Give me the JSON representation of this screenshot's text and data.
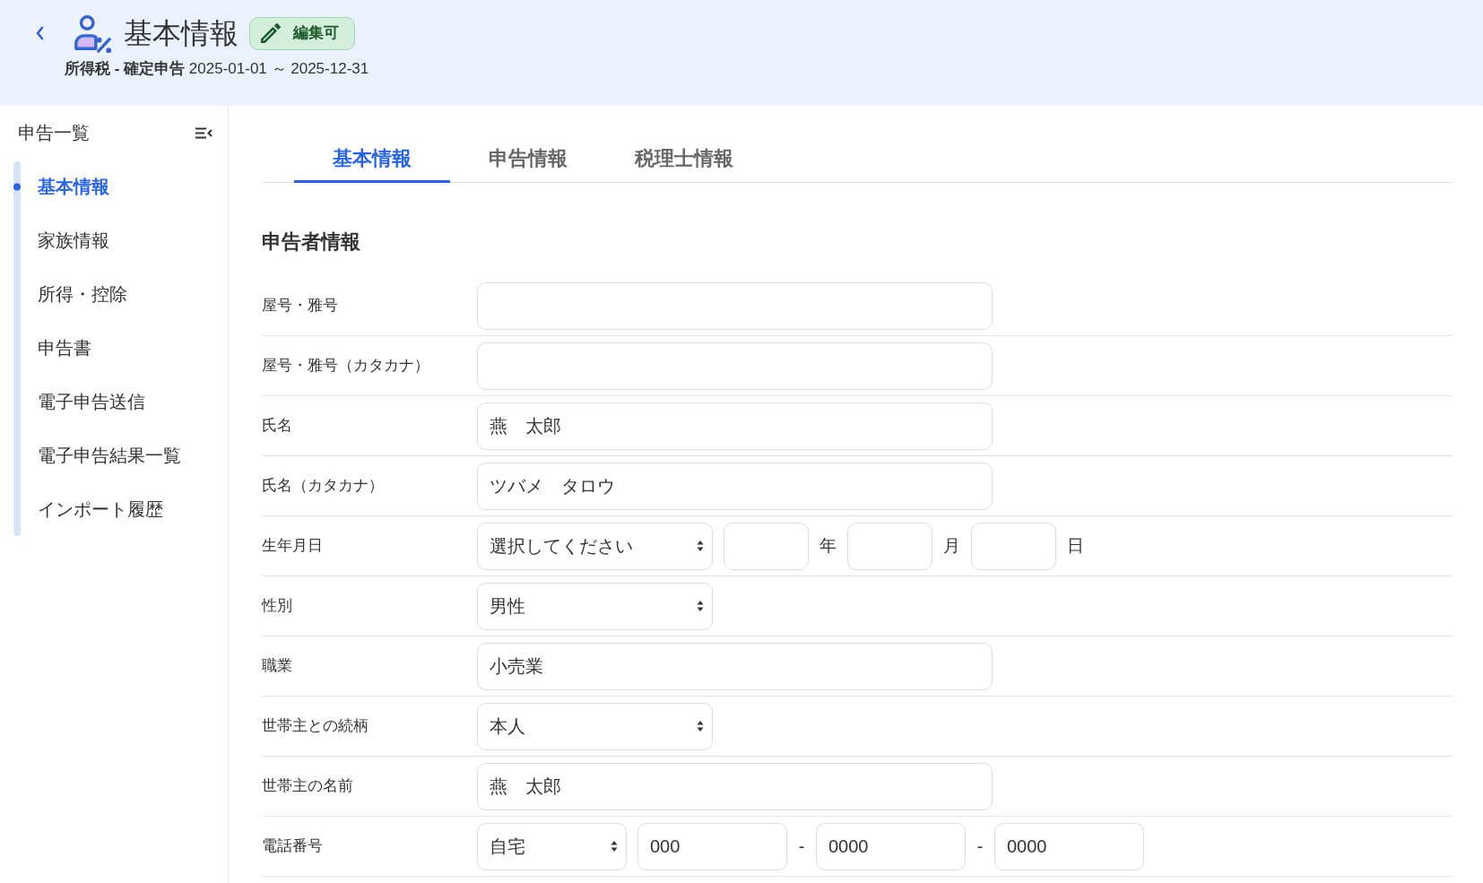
{
  "header": {
    "title": "基本情報",
    "badge": "編集可",
    "subtitle": "**所得税 - 確定申告** 2025-01-01 ～ 2025-12-31"
  },
  "sidebar": {
    "title": "申告一覧",
    "items": [
      {
        "label": "基本情報",
        "selected": true
      },
      {
        "label": "家族情報",
        "selected": false
      },
      {
        "label": "所得・控除",
        "selected": false
      },
      {
        "label": "申告書",
        "selected": false
      },
      {
        "label": "電子申告送信",
        "selected": false
      },
      {
        "label": "電子申告結果一覧",
        "selected": false
      },
      {
        "label": "インポート履歴",
        "selected": false
      }
    ]
  },
  "tabs": [
    {
      "label": "基本情報",
      "selected": true
    },
    {
      "label": "申告情報",
      "selected": false
    },
    {
      "label": "税理士情報",
      "selected": false
    }
  ],
  "section": {
    "title": "申告者情報",
    "fields": [
      {
        "label": "屋号・雅号",
        "kind": "text"
      },
      {
        "label": "屋号・雅号（カタカナ）",
        "kind": "text"
      },
      {
        "label": "氏名",
        "kind": "text",
        "value": "燕　太郎"
      },
      {
        "label": "氏名（カタカナ）",
        "kind": "text",
        "value": "ツバメ　タロウ"
      },
      {
        "label": "生年月日",
        "kind": "date",
        "value": "選択してください",
        "parts": [
          {
            "unit": "年"
          },
          {
            "unit": "月"
          },
          {
            "unit": "日"
          }
        ]
      },
      {
        "label": "性別",
        "kind": "select",
        "value": "男性"
      },
      {
        "label": "職業",
        "kind": "text",
        "value": "小売業"
      },
      {
        "label": "世帯主との続柄",
        "kind": "select",
        "value": "本人"
      },
      {
        "label": "世帯主の名前",
        "kind": "text",
        "value": "燕　太郎"
      },
      {
        "label": "電話番号",
        "kind": "phone",
        "value": "自宅",
        "parts": [
          {
            "value": "000"
          },
          {
            "separator": "-",
            "value": "0000"
          },
          {
            "separator": "-",
            "value": "0000"
          }
        ]
      }
    ]
  }
}
